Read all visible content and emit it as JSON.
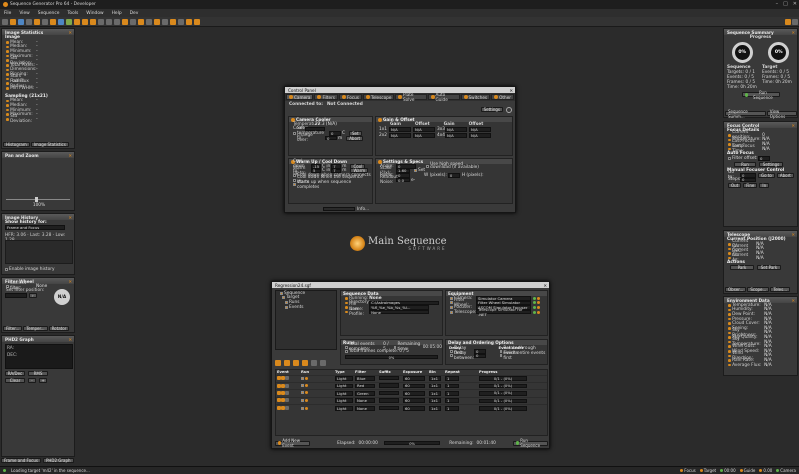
{
  "window": {
    "title": "Sequence Generator Pro 64 - Developer"
  },
  "menu": [
    "File",
    "View",
    "Sequence",
    "Tools",
    "Window",
    "Help",
    "Dev"
  ],
  "colors": {
    "accent": "#d9891d",
    "bg": "#2b2b2b",
    "panel": "#393939"
  },
  "image_stats": {
    "title": "Image Statistics",
    "image_heading": "Image",
    "rows": [
      {
        "k": "Mean:",
        "v": "-"
      },
      {
        "k": "Median:",
        "v": "-"
      },
      {
        "k": "Minimum:",
        "v": "-"
      },
      {
        "k": "Maximum:",
        "v": "-"
      },
      {
        "k": "Std Deviation:",
        "v": "-"
      },
      {
        "k": "Total Pixels:",
        "v": "-"
      },
      {
        "k": "Dimensions:",
        "v": "-"
      },
      {
        "k": "Binning:",
        "v": "-"
      },
      {
        "k": "Stars Found:",
        "v": "-"
      },
      {
        "k": "Half Flux Radius:",
        "v": "-"
      },
      {
        "k": "Min FWHM:",
        "v": "-"
      }
    ],
    "sampling_heading": "Sampling (21x21)",
    "sampling_rows": [
      {
        "k": "Mean:",
        "v": "-"
      },
      {
        "k": "Median:",
        "v": "-"
      },
      {
        "k": "Minimum:",
        "v": "-"
      },
      {
        "k": "Maximum:",
        "v": "-"
      },
      {
        "k": "Std Deviation:",
        "v": "-"
      }
    ],
    "tabs": [
      "Histogram",
      "Image Statistics"
    ]
  },
  "pan_zoom": {
    "title": "Pan and Zoom",
    "zoom": "100%"
  },
  "image_history": {
    "title": "Image History",
    "show_label": "Show history for:",
    "select": "Frame and Focus",
    "summary": "HFR: 3.06 · Last: 3.28 · Low: 1.28",
    "enable": "Enable image history"
  },
  "filter_wheel": {
    "title": "Filter Wheel",
    "current_filter": "Current filter:",
    "current_val": "None",
    "set_label": "Set filter position:",
    "badge": "N/A",
    "tabs": [
      "Filter...",
      "Temper...",
      "Rotator"
    ]
  },
  "phd2": {
    "title": "PHD2 Graph",
    "ra": "RA:",
    "dec": "DEC:",
    "nav": [
      "RA/Dec",
      "RMS",
      "Clear"
    ]
  },
  "bottom_tabs": [
    "Frame and Focus",
    "PHD2 Graph"
  ],
  "sequence_summary": {
    "title": "Sequence Summary",
    "progress_label": "Progress",
    "gauges": [
      "0%",
      "0%"
    ],
    "seq_col": [
      "Sequence",
      "Targets:",
      "Events:",
      "Frames:",
      "Time:"
    ],
    "seq_val": [
      "",
      "0 / 1",
      "0 / 5",
      "0 / 5",
      "0h 20m"
    ],
    "tgt_col": [
      "Target",
      "Events:",
      "Frames:",
      "Time:"
    ],
    "tgt_val": [
      "",
      "0 / 5",
      "0 / 5",
      "0h 20m"
    ],
    "run_btn": "Run Sequence",
    "tabs": [
      "Sequence Summ...",
      "View Options"
    ]
  },
  "focus_control": {
    "title": "Focus Control",
    "details": "Focus Details",
    "rows": [
      {
        "k": "Current position:",
        "v": "0"
      },
      {
        "k": "Temperature:",
        "v": "N/A"
      },
      {
        "k": "Last Focus Temp:",
        "v": "N/A"
      },
      {
        "k": "Last Focus Time:",
        "v": "N/A"
      }
    ],
    "auto_focus": "Auto Focus",
    "filter_offset": "Filter offset:",
    "run": "Run",
    "settings": "Settings",
    "manual": "Manual Focuser Control",
    "goto": "Go to:",
    "go": "Go to",
    "steps": "Steps:",
    "abort": "Abort",
    "move": [
      "Out",
      "Fine",
      "In"
    ]
  },
  "telescope": {
    "title": "Telescope",
    "current": "Current Position (J2000)",
    "rows": [
      {
        "k": "Current RA:",
        "v": "N/A"
      },
      {
        "k": "Current DEC:",
        "v": "N/A"
      },
      {
        "k": "Current Alt:",
        "v": "N/A"
      },
      {
        "k": "Current Az:",
        "v": "N/A"
      }
    ],
    "actions": "Actions",
    "park": "Park",
    "set_park": "Set Park",
    "tabs": [
      "Obser...",
      "Scope...",
      "Teles..."
    ]
  },
  "environment": {
    "title": "Environment Data",
    "rows": [
      "Temperature:",
      "Humidity:",
      "Dew Point:",
      "Pressure:",
      "Cloud Cover:",
      "Seeing:",
      "Sky Brightness:",
      "Sky Quality:",
      "Sky Temperature:",
      "Wind Gust:",
      "Wind Speed:",
      "Wind Direction:",
      "Rain Rate:",
      "Average Flux:"
    ],
    "value": "N/A"
  },
  "control_panel": {
    "title": "Control Panel",
    "tabs": [
      "Camera",
      "Filters",
      "Focus",
      "Telescope",
      "Plate Solve",
      "Auto Guide",
      "Switches",
      "Other"
    ],
    "connected_to": "Connected to:",
    "connected_val": "Not Connected",
    "settings": "Settings",
    "cooler": {
      "title": "Camera Cooler",
      "temp": "Temperature:",
      "temp_val": "22.3 (N/A)",
      "cooler": "Cooler:",
      "set": "Set temperature to:",
      "change": "change over:"
    },
    "gain": {
      "title": "Gain & Offset",
      "cols": [
        "Gain",
        "Offset",
        "Gain",
        "Offset"
      ]
    },
    "warm": {
      "title": "Warm Up / Cool Down",
      "cool": "Cool down to:",
      "warm": "Warm up to:",
      "opts": [
        "Cool down when camera connects",
        "Cool down when the sequence starts",
        "Warm up when sequence completes"
      ]
    },
    "settings_specs": {
      "title": "Settings & Specs",
      "angle": "Angle:",
      "scale": "Scale (\"/x):",
      "pixels": "Pixels:",
      "readout": "Readout Noise:",
      "hsd": "Use high speed download (if available)",
      "wpx": "W (pixels):",
      "hpx": "H (pixels):"
    },
    "info": "Info..."
  },
  "logo": {
    "main": "Main Sequence",
    "sub": "SOFTWARE"
  },
  "sequence_dialog": {
    "title": "Regression24.sgf",
    "tree": [
      "Sequence",
      "Target",
      "Runs",
      "Events"
    ],
    "seq_data": {
      "title": "Sequence Data",
      "running": "Running:",
      "running_val": "None",
      "directory": "Directory:",
      "directory_val": "C:\\Astroimages",
      "file": "File Name:",
      "file_val": "%fl_%e_%b_%s_%l...",
      "profile": "User Profile:",
      "profile_val": "None"
    },
    "equipment": {
      "title": "Equipment",
      "rows": [
        {
          "k": "Camera:",
          "v": "Simulator Camera"
        },
        {
          "k": "Filter Wheel:",
          "v": "Filter Wheel Simulator"
        },
        {
          "k": "Focuser:",
          "v": "ASCOM Simulator Focuser"
        },
        {
          "k": "Telescope:",
          "v": "Telescope Simulator for .NET"
        }
      ]
    },
    "runs": {
      "title": "Runs",
      "total": "Total events complete:",
      "total_val": "0 / 5",
      "remain": "Remaining time:",
      "remain_val": "00:05:00",
      "frames": "Total frames complete:",
      "frames_val": "0 / 5",
      "pct": "0%"
    },
    "delay": {
      "title": "Delay and Ordering Options",
      "delay": "Delay",
      "first": "Delay first:",
      "between": "Delay between:",
      "order": "Event order",
      "rotate": "Rotate through events",
      "finish": "Finish entire events first"
    },
    "events": {
      "headers": [
        "Event",
        "Run",
        "Type",
        "Filter",
        "Suffix",
        "Exposure",
        "Bin",
        "Repeat",
        "Progress"
      ],
      "rows": [
        {
          "type": "Light",
          "filter": "Blue",
          "suffix": "",
          "exp": "60",
          "bin": "1x1",
          "repeat": "1",
          "progress": "0/1 - (0%)"
        },
        {
          "type": "Light",
          "filter": "Red",
          "suffix": "",
          "exp": "60",
          "bin": "1x1",
          "repeat": "1",
          "progress": "0/1 - (0%)"
        },
        {
          "type": "Light",
          "filter": "Green",
          "suffix": "",
          "exp": "60",
          "bin": "1x1",
          "repeat": "1",
          "progress": "0/1 - (0%)"
        },
        {
          "type": "Light",
          "filter": "None",
          "suffix": "",
          "exp": "60",
          "bin": "1x1",
          "repeat": "1",
          "progress": "0/1 - (0%)"
        },
        {
          "type": "Light",
          "filter": "None",
          "suffix": "",
          "exp": "60",
          "bin": "1x1",
          "repeat": "1",
          "progress": "0/1 - (0%)"
        }
      ]
    },
    "add_event": "Add New Event",
    "elapsed": "Elapsed:",
    "elapsed_val": "00:00:00",
    "pct": "0%",
    "remaining": "Remaining:",
    "remaining_val": "00:01:40",
    "run": "Run Sequence"
  },
  "status": {
    "left": "Loading target 'm42' in the sequence...",
    "items": [
      "Focus",
      "Target",
      "00:00",
      "Guide",
      "0.00",
      "Camera"
    ]
  }
}
